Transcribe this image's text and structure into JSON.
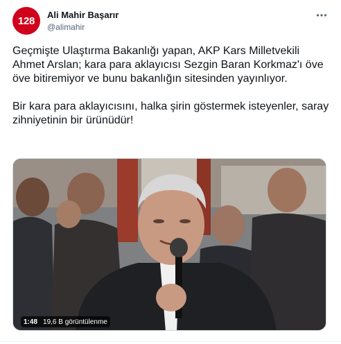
{
  "tweet": {
    "avatar_text": "128",
    "author_name": "Ali Mahir Başarır",
    "author_handle": "@alimahir",
    "paragraphs": [
      "Geçmişte Ulaştırma Bakanlığı yapan, AKP Kars Milletvekili Ahmet Arslan; kara para aklayıcısı Sezgin Baran Korkmaz'ı öve öve bitiremiyor ve bunu bakanlığın sitesinden yayınlıyor.",
      "Bir kara para aklayıcısını, halka şirin göstermek isteyenler, saray zihniyetinin bir ürünüdür!"
    ],
    "video": {
      "duration": "1:48",
      "views": "19,6 B görüntülenme"
    },
    "more_icon": "more-horizontal-icon",
    "colors": {
      "avatar_bg": "#d0021b",
      "text": "#0f1419",
      "secondary": "#536471"
    }
  }
}
